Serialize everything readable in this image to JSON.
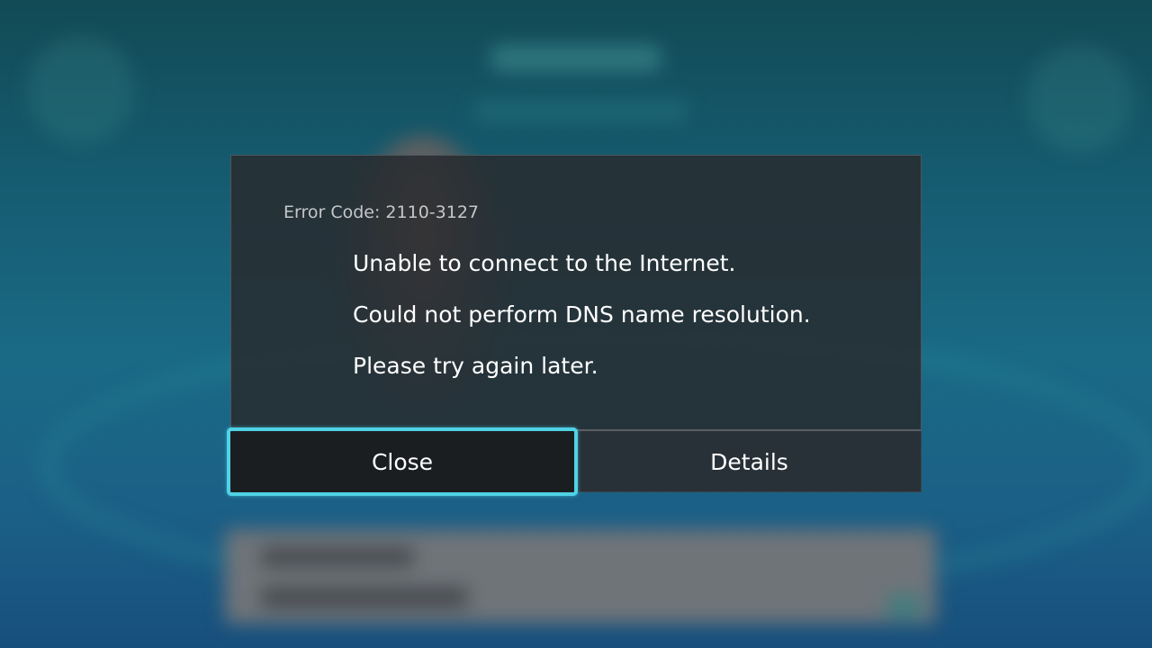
{
  "dialog": {
    "error_code": "Error Code: 2110-3127",
    "messages": [
      "Unable to connect to the Internet.",
      "Could not perform DNS name resolution.",
      "Please try again later."
    ],
    "buttons": {
      "close_label": "Close",
      "details_label": "Details"
    }
  },
  "colors": {
    "focus_outline": "#4fd2e6",
    "dialog_background": "#282b2e",
    "text_primary": "#ffffff",
    "text_secondary": "#c4c7ca"
  }
}
